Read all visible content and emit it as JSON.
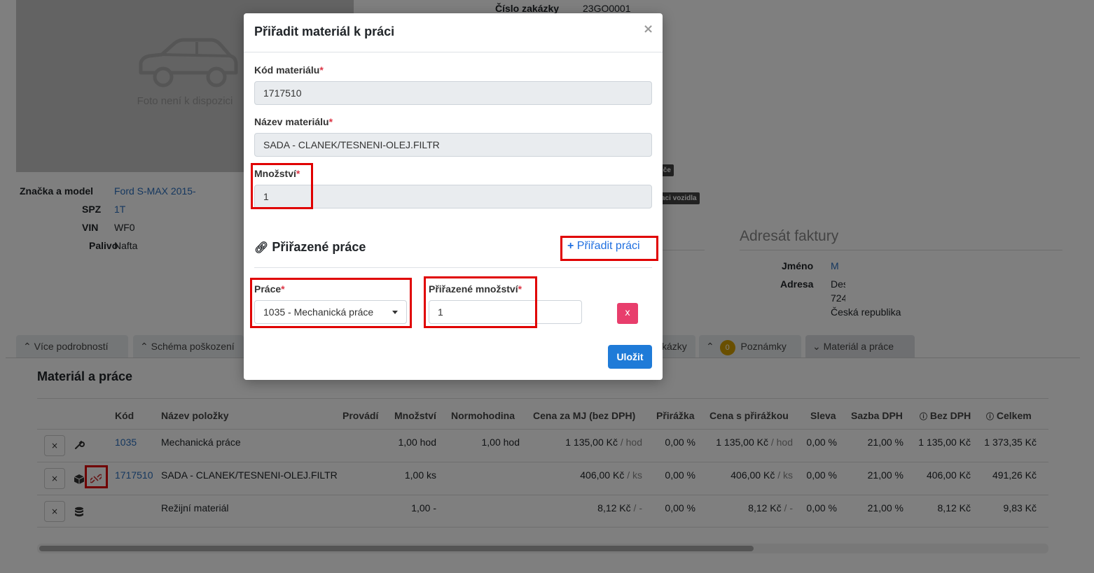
{
  "order": {
    "number_label": "Číslo zakázky",
    "number_value": "23GO0001"
  },
  "photo": {
    "caption": "Foto není k dispozici"
  },
  "vehicle": {
    "brand_label": "Značka a model",
    "brand_value": "Ford S-MAX 2015-",
    "spz_label": "SPZ",
    "spz_value": "1T",
    "vin_label": "VIN",
    "vin_value": "WF0",
    "fuel_label": "Palivo",
    "fuel_value": "Nafta"
  },
  "badges": {
    "b1": "iče",
    "b2": "aci vozidla"
  },
  "invoice": {
    "title": "Adresát faktury",
    "name_label": "Jméno",
    "name_value": "M",
    "address_label": "Adresa",
    "address_line1": "Des",
    "address_line2": "724",
    "address_line3": "Česká republika"
  },
  "tabs": {
    "more": "Více podrobností",
    "damage": "Schéma poškození",
    "orders": "kázky",
    "notes_count": "0",
    "notes": "Poznámky",
    "material": "Materiál a práce"
  },
  "panel": {
    "title": "Materiál a práce"
  },
  "table": {
    "headers": {
      "code": "Kód",
      "name": "Název položky",
      "performs": "Provádí",
      "qty": "Množství",
      "norm": "Normohodina",
      "price": "Cena za MJ (bez DPH)",
      "markup": "Přirážka",
      "price_markup": "Cena s přirážkou",
      "discount": "Sleva",
      "vat": "Sazba DPH",
      "no_vat": "Bez DPH",
      "total": "Celkem"
    },
    "rows": [
      {
        "code": "1035",
        "name": "Mechanická práce",
        "qty": "1,00 hod",
        "norm": "1,00 hod",
        "price": "1 135,00 Kč",
        "price_unit": "/ hod",
        "markup": "0,00 %",
        "price_markup": "1 135,00 Kč",
        "pm_unit": "/ hod",
        "discount": "0,00 %",
        "vat": "21,00 %",
        "no_vat": "1 135,00 Kč",
        "total": "1 373,35 Kč"
      },
      {
        "code": "1717510",
        "name": "SADA - CLANEK/TESNENI-OLEJ.FILTR",
        "qty": "1,00 ks",
        "norm": "",
        "price": "406,00 Kč",
        "price_unit": "/ ks",
        "markup": "0,00 %",
        "price_markup": "406,00 Kč",
        "pm_unit": "/ ks",
        "discount": "0,00 %",
        "vat": "21,00 %",
        "no_vat": "406,00 Kč",
        "total": "491,26 Kč"
      },
      {
        "code": "",
        "name": "Režijní materiál",
        "qty": "1,00 -",
        "norm": "",
        "price": "8,12 Kč",
        "price_unit": "/ -",
        "markup": "0,00 %",
        "price_markup": "8,12 Kč",
        "pm_unit": "/ -",
        "discount": "0,00 %",
        "vat": "21,00 %",
        "no_vat": "8,12 Kč",
        "total": "9,83 Kč"
      }
    ],
    "delete_symbol": "×"
  },
  "modal": {
    "title": "Přiřadit materiál k práci",
    "close_symbol": "×",
    "code_label": "Kód materiálu",
    "code_value": "1717510",
    "name_label": "Název materiálu",
    "name_value": "SADA - CLANEK/TESNENI-OLEJ.FILTR",
    "qty_label": "Množství",
    "qty_value": "1",
    "required_mark": "*",
    "assigned_title": "Přiřazené práce",
    "assign_link": "Přiřadit práci",
    "plus_symbol": "+",
    "work_label": "Práce",
    "work_value": "1035 - Mechanická práce",
    "assigned_qty_label": "Přiřazené množství",
    "assigned_qty_value": "1",
    "delete_label": "x",
    "save_label": "Uložit"
  },
  "colors": {
    "accent": "#1f7bd8",
    "danger": "#e83e6c",
    "highlight": "#e00000",
    "link": "#2a6fbf"
  }
}
